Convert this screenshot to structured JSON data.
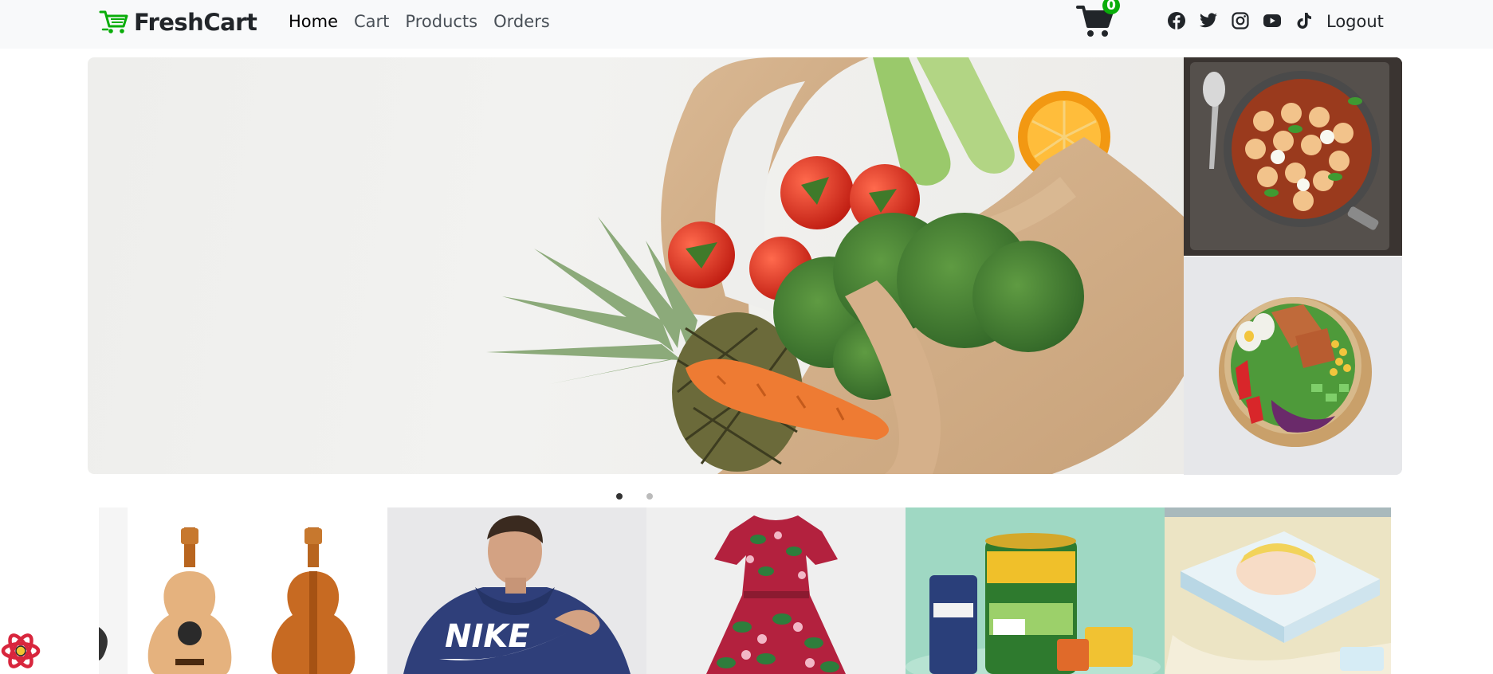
{
  "brand": {
    "name": "FreshCart",
    "accent": "#0aad0a"
  },
  "nav": {
    "links": [
      {
        "label": "Home",
        "active": true
      },
      {
        "label": "Cart",
        "active": false
      },
      {
        "label": "Products",
        "active": false
      },
      {
        "label": "Orders",
        "active": false
      }
    ]
  },
  "cart": {
    "count": "0",
    "icon": "cart-icon",
    "badge_color": "#0aad0a"
  },
  "social": [
    "facebook-icon",
    "twitter-icon",
    "instagram-icon",
    "youtube-icon",
    "tiktok-icon"
  ],
  "logout_label": "Logout",
  "hero": {
    "main_image": "grocery-bag-photo",
    "side_images": [
      "gnocchi-pan-photo",
      "salad-bowl-photo"
    ]
  },
  "carousel_dots": {
    "count": 2,
    "active_index": 0
  },
  "categories": [
    {
      "image": "guitar-photo"
    },
    {
      "image": "nike-hoodie-photo"
    },
    {
      "image": "floral-dress-photo"
    },
    {
      "image": "grocery-products-photo"
    },
    {
      "image": "baby-diapers-photo"
    }
  ]
}
